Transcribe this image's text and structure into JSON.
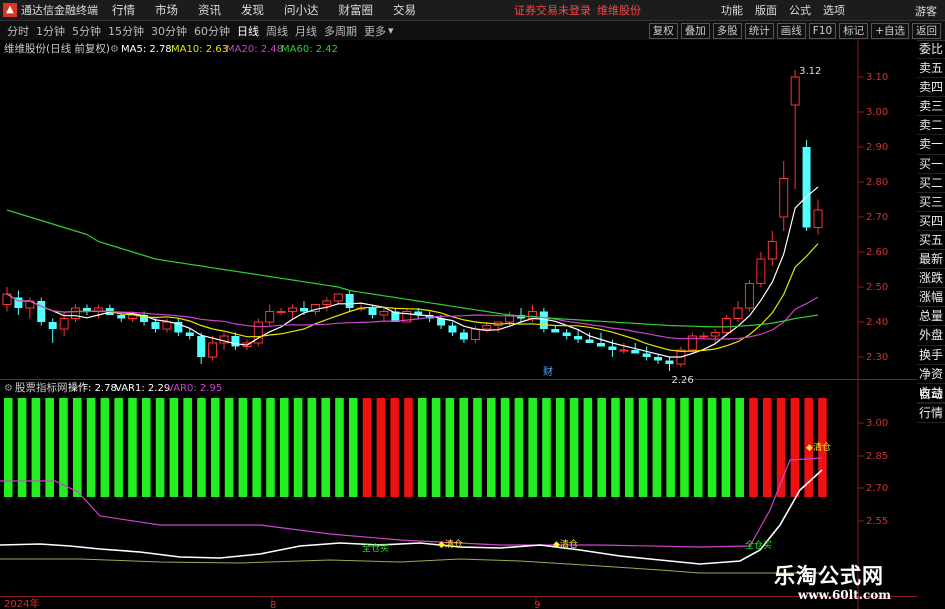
{
  "app": {
    "title": "通达信金融终端",
    "menu": [
      "行情",
      "市场",
      "资讯",
      "发现",
      "问小达",
      "财富圈",
      "交易"
    ],
    "notice": "证券交易未登录",
    "notice2": "维维股份",
    "right_menu": [
      "功能",
      "版面",
      "公式",
      "选项"
    ],
    "guest": "游客"
  },
  "periods": [
    "分时",
    "1分钟",
    "5分钟",
    "15分钟",
    "30分钟",
    "60分钟",
    "日线",
    "周线",
    "月线",
    "多周期",
    "更多"
  ],
  "active_period": "日线",
  "period_buttons": [
    "复权",
    "叠加",
    "多股",
    "统计",
    "画线",
    "F10",
    "标记",
    "+自选",
    "返回"
  ],
  "main": {
    "stock_label": "维维股份(日线 前复权)",
    "ma": [
      {
        "name": "MA5",
        "value": "2.78",
        "color": "#ffffff"
      },
      {
        "name": "MA10",
        "value": "2.63",
        "color": "#e6e600"
      },
      {
        "name": "MA20",
        "value": "2.48",
        "color": "#cc44cc"
      },
      {
        "name": "MA60",
        "value": "2.42",
        "color": "#33cc33"
      }
    ],
    "high_label": "3.12",
    "low_label": "2.26",
    "fin_marker": "财",
    "y_ticks": [
      "3.10",
      "3.00",
      "2.90",
      "2.80",
      "2.70",
      "2.60",
      "2.50",
      "2.40",
      "2.30"
    ]
  },
  "indicator": {
    "name": "股票指标网",
    "items": [
      {
        "name": "操作",
        "value": "2.78",
        "color": "#ffffff"
      },
      {
        "name": "VAR1",
        "value": "2.29",
        "color": "#ffffff"
      },
      {
        "name": "VAR0",
        "value": "2.95",
        "color": "#cc44cc"
      }
    ],
    "y_ticks": [
      "3.00",
      "2.85",
      "2.70",
      "2.55"
    ],
    "signals": [
      "全仓买",
      "清仓",
      "清仓",
      "全仓买",
      "清仓"
    ]
  },
  "xaxis": [
    "2024年",
    "8",
    "9"
  ],
  "side_panel": [
    "委比",
    "卖五",
    "卖四",
    "卖三",
    "卖二",
    "卖一",
    "买一",
    "买二",
    "买三",
    "买四",
    "买五",
    "最新",
    "涨跌",
    "涨幅",
    "总量",
    "外盘",
    "换手",
    "净资",
    "收益"
  ],
  "side_panel2": [
    "自动",
    "行情"
  ],
  "watermark": {
    "title": "乐淘公式网",
    "url": "www.60lt.com"
  },
  "colors": {
    "up": "#ff3333",
    "down": "#54ffff",
    "green_bar": "#22ee22",
    "red_bar": "#ee1111"
  },
  "chart_data": {
    "type": "candlestick",
    "title": "维维股份(日线 前复权)",
    "ylim": [
      2.24,
      3.16
    ],
    "candles": [
      {
        "o": 2.45,
        "h": 2.5,
        "l": 2.43,
        "c": 2.48
      },
      {
        "o": 2.47,
        "h": 2.49,
        "l": 2.42,
        "c": 2.44
      },
      {
        "o": 2.44,
        "h": 2.47,
        "l": 2.41,
        "c": 2.46
      },
      {
        "o": 2.46,
        "h": 2.47,
        "l": 2.39,
        "c": 2.4
      },
      {
        "o": 2.4,
        "h": 2.41,
        "l": 2.34,
        "c": 2.38
      },
      {
        "o": 2.38,
        "h": 2.43,
        "l": 2.36,
        "c": 2.41
      },
      {
        "o": 2.41,
        "h": 2.45,
        "l": 2.4,
        "c": 2.44
      },
      {
        "o": 2.44,
        "h": 2.45,
        "l": 2.42,
        "c": 2.43
      },
      {
        "o": 2.43,
        "h": 2.45,
        "l": 2.41,
        "c": 2.44
      },
      {
        "o": 2.44,
        "h": 2.45,
        "l": 2.42,
        "c": 2.42
      },
      {
        "o": 2.42,
        "h": 2.43,
        "l": 2.4,
        "c": 2.41
      },
      {
        "o": 2.41,
        "h": 2.43,
        "l": 2.4,
        "c": 2.42
      },
      {
        "o": 2.42,
        "h": 2.43,
        "l": 2.39,
        "c": 2.4
      },
      {
        "o": 2.4,
        "h": 2.41,
        "l": 2.37,
        "c": 2.38
      },
      {
        "o": 2.38,
        "h": 2.41,
        "l": 2.37,
        "c": 2.4
      },
      {
        "o": 2.4,
        "h": 2.41,
        "l": 2.36,
        "c": 2.37
      },
      {
        "o": 2.37,
        "h": 2.38,
        "l": 2.35,
        "c": 2.36
      },
      {
        "o": 2.36,
        "h": 2.37,
        "l": 2.28,
        "c": 2.3
      },
      {
        "o": 2.3,
        "h": 2.36,
        "l": 2.29,
        "c": 2.34
      },
      {
        "o": 2.34,
        "h": 2.37,
        "l": 2.32,
        "c": 2.36
      },
      {
        "o": 2.36,
        "h": 2.37,
        "l": 2.32,
        "c": 2.33
      },
      {
        "o": 2.33,
        "h": 2.35,
        "l": 2.32,
        "c": 2.34
      },
      {
        "o": 2.34,
        "h": 2.41,
        "l": 2.33,
        "c": 2.4
      },
      {
        "o": 2.4,
        "h": 2.45,
        "l": 2.39,
        "c": 2.43
      },
      {
        "o": 2.43,
        "h": 2.44,
        "l": 2.42,
        "c": 2.43
      },
      {
        "o": 2.43,
        "h": 2.45,
        "l": 2.41,
        "c": 2.44
      },
      {
        "o": 2.44,
        "h": 2.46,
        "l": 2.42,
        "c": 2.43
      },
      {
        "o": 2.43,
        "h": 2.45,
        "l": 2.42,
        "c": 2.45
      },
      {
        "o": 2.45,
        "h": 2.47,
        "l": 2.43,
        "c": 2.46
      },
      {
        "o": 2.46,
        "h": 2.48,
        "l": 2.45,
        "c": 2.48
      },
      {
        "o": 2.48,
        "h": 2.49,
        "l": 2.43,
        "c": 2.44
      },
      {
        "o": 2.44,
        "h": 2.45,
        "l": 2.43,
        "c": 2.44
      },
      {
        "o": 2.44,
        "h": 2.45,
        "l": 2.41,
        "c": 2.42
      },
      {
        "o": 2.42,
        "h": 2.44,
        "l": 2.4,
        "c": 2.43
      },
      {
        "o": 2.43,
        "h": 2.44,
        "l": 2.41,
        "c": 2.4
      },
      {
        "o": 2.4,
        "h": 2.44,
        "l": 2.4,
        "c": 2.43
      },
      {
        "o": 2.43,
        "h": 2.44,
        "l": 2.41,
        "c": 2.42
      },
      {
        "o": 2.42,
        "h": 2.43,
        "l": 2.4,
        "c": 2.41
      },
      {
        "o": 2.41,
        "h": 2.42,
        "l": 2.38,
        "c": 2.39
      },
      {
        "o": 2.39,
        "h": 2.4,
        "l": 2.36,
        "c": 2.37
      },
      {
        "o": 2.37,
        "h": 2.38,
        "l": 2.34,
        "c": 2.35
      },
      {
        "o": 2.35,
        "h": 2.39,
        "l": 2.34,
        "c": 2.38
      },
      {
        "o": 2.38,
        "h": 2.4,
        "l": 2.37,
        "c": 2.39
      },
      {
        "o": 2.39,
        "h": 2.4,
        "l": 2.37,
        "c": 2.4
      },
      {
        "o": 2.4,
        "h": 2.43,
        "l": 2.39,
        "c": 2.42
      },
      {
        "o": 2.42,
        "h": 2.44,
        "l": 2.4,
        "c": 2.41
      },
      {
        "o": 2.41,
        "h": 2.45,
        "l": 2.4,
        "c": 2.43
      },
      {
        "o": 2.43,
        "h": 2.44,
        "l": 2.37,
        "c": 2.38
      },
      {
        "o": 2.38,
        "h": 2.39,
        "l": 2.37,
        "c": 2.37
      },
      {
        "o": 2.37,
        "h": 2.38,
        "l": 2.35,
        "c": 2.36
      },
      {
        "o": 2.36,
        "h": 2.38,
        "l": 2.34,
        "c": 2.35
      },
      {
        "o": 2.35,
        "h": 2.37,
        "l": 2.34,
        "c": 2.34
      },
      {
        "o": 2.34,
        "h": 2.37,
        "l": 2.33,
        "c": 2.33
      },
      {
        "o": 2.33,
        "h": 2.35,
        "l": 2.3,
        "c": 2.32
      },
      {
        "o": 2.32,
        "h": 2.34,
        "l": 2.31,
        "c": 2.32
      },
      {
        "o": 2.32,
        "h": 2.34,
        "l": 2.31,
        "c": 2.31
      },
      {
        "o": 2.31,
        "h": 2.33,
        "l": 2.29,
        "c": 2.3
      },
      {
        "o": 2.3,
        "h": 2.31,
        "l": 2.28,
        "c": 2.29
      },
      {
        "o": 2.29,
        "h": 2.3,
        "l": 2.26,
        "c": 2.28
      },
      {
        "o": 2.28,
        "h": 2.33,
        "l": 2.27,
        "c": 2.32
      },
      {
        "o": 2.32,
        "h": 2.37,
        "l": 2.31,
        "c": 2.36
      },
      {
        "o": 2.36,
        "h": 2.37,
        "l": 2.35,
        "c": 2.36
      },
      {
        "o": 2.36,
        "h": 2.38,
        "l": 2.34,
        "c": 2.37
      },
      {
        "o": 2.37,
        "h": 2.42,
        "l": 2.36,
        "c": 2.41
      },
      {
        "o": 2.41,
        "h": 2.46,
        "l": 2.4,
        "c": 2.44
      },
      {
        "o": 2.44,
        "h": 2.52,
        "l": 2.43,
        "c": 2.51
      },
      {
        "o": 2.51,
        "h": 2.6,
        "l": 2.5,
        "c": 2.58
      },
      {
        "o": 2.58,
        "h": 2.66,
        "l": 2.56,
        "c": 2.63
      },
      {
        "o": 2.7,
        "h": 2.86,
        "l": 2.66,
        "c": 2.81
      },
      {
        "o": 3.02,
        "h": 3.12,
        "l": 2.78,
        "c": 3.1
      },
      {
        "o": 2.9,
        "h": 2.92,
        "l": 2.66,
        "c": 2.67
      },
      {
        "o": 2.67,
        "h": 2.75,
        "l": 2.65,
        "c": 2.72
      }
    ],
    "ma60": [
      2.72,
      2.71,
      2.7,
      2.69,
      2.68,
      2.67,
      2.66,
      2.65,
      2.63,
      2.62,
      2.61,
      2.6,
      2.59,
      2.58,
      2.575,
      2.57,
      2.565,
      2.56,
      2.555,
      2.55,
      2.545,
      2.54,
      2.535,
      2.53,
      2.525,
      2.52,
      2.515,
      2.51,
      2.505,
      2.5,
      2.49,
      2.485,
      2.48,
      2.475,
      2.47,
      2.465,
      2.46,
      2.455,
      2.45,
      2.445,
      2.44,
      2.435,
      2.43,
      2.425,
      2.42,
      2.417,
      2.415,
      2.413,
      2.41,
      2.408,
      2.406,
      2.404,
      2.402,
      2.4,
      2.398,
      2.396,
      2.394,
      2.392,
      2.39,
      2.389,
      2.388,
      2.387,
      2.386,
      2.386,
      2.388,
      2.39,
      2.393,
      2.397,
      2.403,
      2.41,
      2.415,
      2.42
    ]
  }
}
